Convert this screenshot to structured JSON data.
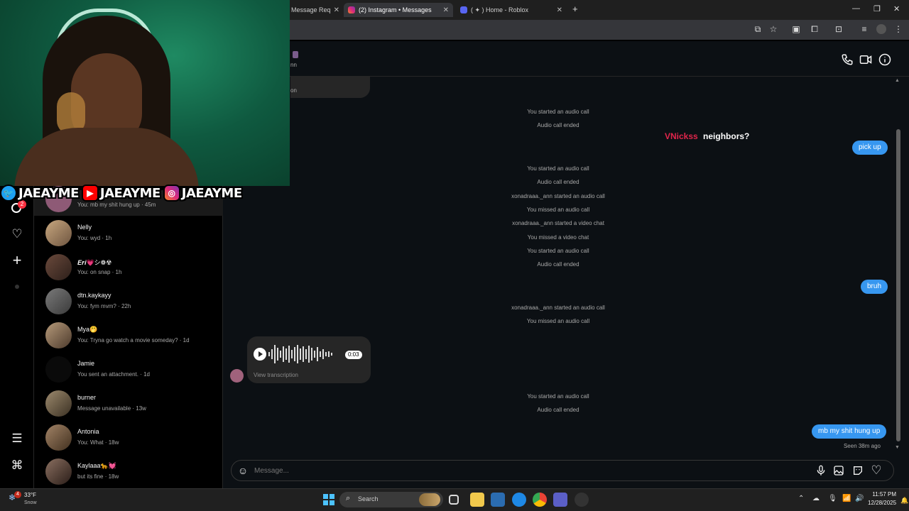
{
  "tabs": [
    {
      "label": "Message Req",
      "active": false
    },
    {
      "label": "(2) Instagram • Messages",
      "active": true
    },
    {
      "label": "( ✦ ) Home - Roblox",
      "active": false
    }
  ],
  "thread": {
    "header_name_fragment": "nn",
    "partial_bubble_text": "on",
    "system_messages": [
      "You started an audio call",
      "Audio call ended",
      "You started an audio call",
      "Audio call ended",
      "xonadraaa._ann started an audio call",
      "You missed an audio call",
      "xonadraaa._ann started a video chat",
      "You missed a video chat",
      "You started an audio call",
      "Audio call ended",
      "xonadraaa._ann started an audio call",
      "You missed an audio call",
      "You started an audio call",
      "Audio call ended"
    ],
    "sent_messages": [
      "pick up",
      "bruh",
      "mb my shit hung up"
    ],
    "seen_status": "Seen 38m ago",
    "voice_message": {
      "duration": "0:03",
      "transcription_link": "View transcription"
    },
    "composer_placeholder": "Message..."
  },
  "overlay": {
    "chat_name": "VNickss",
    "chat_text": "neighbors?",
    "chat_name_color": "#e0254b",
    "socials": [
      {
        "platform": "twitter-icon",
        "handle": "JAEAYME",
        "color": "#1da1f2"
      },
      {
        "platform": "youtube-icon",
        "handle": "JAEAYME",
        "color": "#ff0000"
      },
      {
        "platform": "instagram-icon",
        "handle": "JAEAYME",
        "color": "#d62976"
      }
    ]
  },
  "nav": {
    "notification_count": "2"
  },
  "conversations": [
    {
      "name": "",
      "preview": "You: mb my shit hung up · 45m"
    },
    {
      "name": "Nelly",
      "preview": "You: wyd · 1h"
    },
    {
      "name": "𝑬𝒓𝒊💗シ❁☢",
      "preview": "You: on snap · 1h"
    },
    {
      "name": "dtn.kaykayy",
      "preview": "You: fym mvm? · 22h"
    },
    {
      "name": "Mya🤭",
      "preview": "You: Tryna go watch a movie someday? · 1d"
    },
    {
      "name": "Jamie",
      "preview": "You sent an attachment. · 1d"
    },
    {
      "name": "burner",
      "preview": "Message unavailable · 13w"
    },
    {
      "name": "Antonia",
      "preview": "You: What · 18w"
    },
    {
      "name": "Kaylaaa🐆💓",
      "preview": "but its fine · 18w"
    }
  ],
  "taskbar": {
    "weather_temp": "33°F",
    "weather_desc": "Snow",
    "weather_badge": "4",
    "search_label": "Search",
    "time": "11:57 PM",
    "date": "12/28/2025"
  },
  "colors": {
    "accent_bubble": "#3797f0",
    "thread_bg": "#0c1014",
    "badge": "#ff3040"
  }
}
